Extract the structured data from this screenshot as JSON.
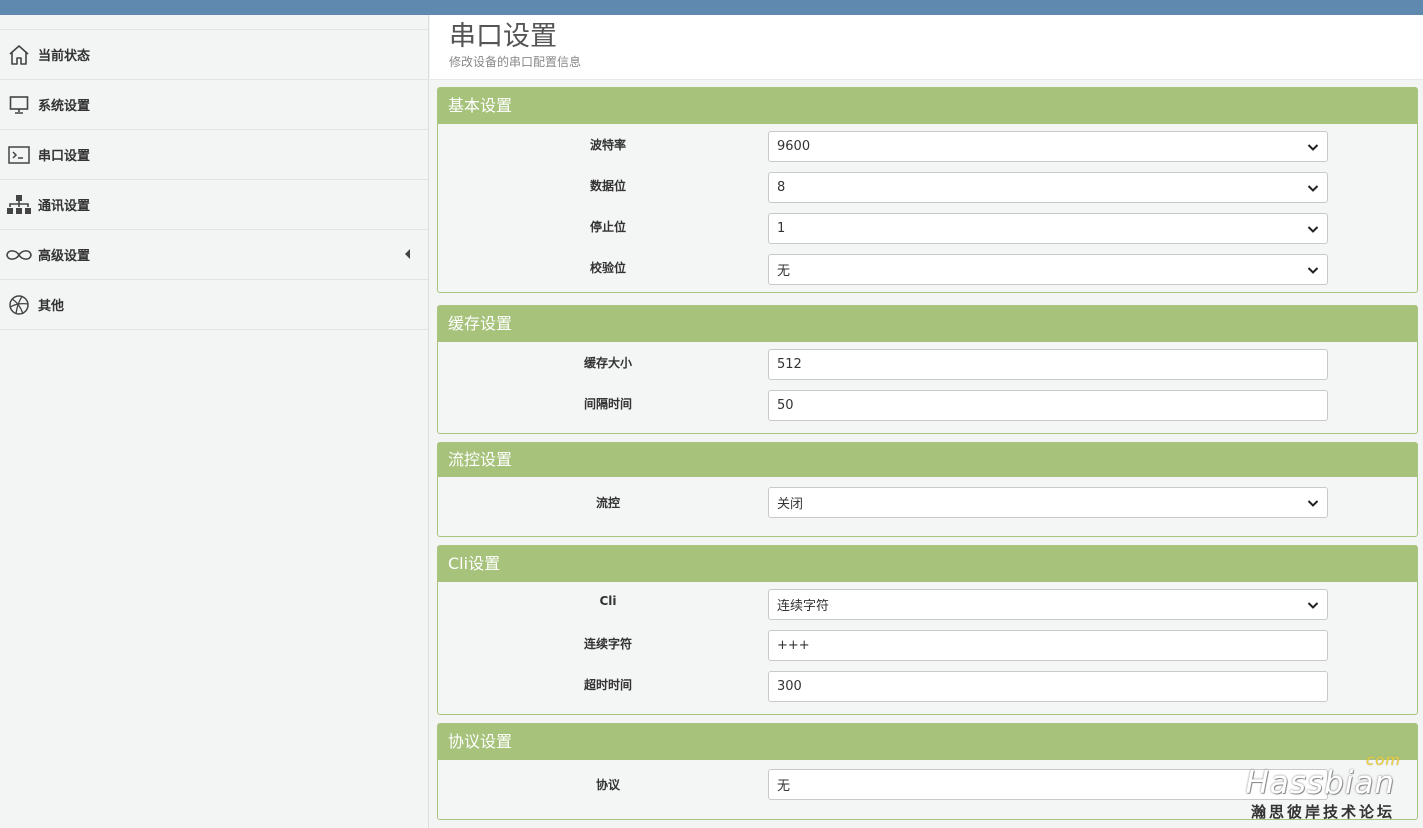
{
  "sidebar": {
    "items": [
      {
        "label": "当前状态",
        "icon": "home-icon"
      },
      {
        "label": "系统设置",
        "icon": "monitor-icon"
      },
      {
        "label": "串口设置",
        "icon": "terminal-icon"
      },
      {
        "label": "通讯设置",
        "icon": "sitemap-icon"
      },
      {
        "label": "高级设置",
        "icon": "infinity-icon"
      },
      {
        "label": "其他",
        "icon": "basketball-icon"
      }
    ]
  },
  "header": {
    "title": "串口设置",
    "subtitle": "修改设备的串口配置信息"
  },
  "panels": {
    "basic": {
      "title": "基本设置",
      "baud_label": "波特率",
      "baud_value": "9600",
      "databits_label": "数据位",
      "databits_value": "8",
      "stopbits_label": "停止位",
      "stopbits_value": "1",
      "parity_label": "校验位",
      "parity_value": "无"
    },
    "buffer": {
      "title": "缓存设置",
      "size_label": "缓存大小",
      "size_value": "512",
      "interval_label": "间隔时间",
      "interval_value": "50"
    },
    "flow": {
      "title": "流控设置",
      "flow_label": "流控",
      "flow_value": "关闭"
    },
    "cli": {
      "title": "Cli设置",
      "cli_label": "Cli",
      "cli_value": "连续字符",
      "chars_label": "连续字符",
      "chars_value": "+++",
      "timeout_label": "超时时间",
      "timeout_value": "300"
    },
    "protocol": {
      "title": "协议设置",
      "protocol_label": "协议",
      "protocol_value": "无"
    }
  },
  "watermark": {
    "brand": "Hassbian",
    "tld": "com",
    "tagline": "瀚思彼岸技术论坛"
  },
  "colors": {
    "topbar": "#6089b0",
    "panel_header": "#a6c27b",
    "panel_border": "#a9c47f"
  }
}
